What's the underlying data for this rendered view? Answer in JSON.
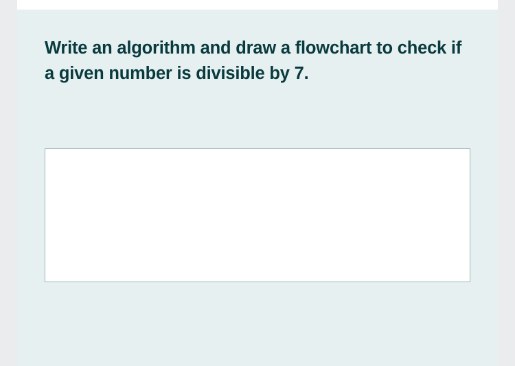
{
  "question": {
    "prompt": "Write an algorithm and draw a flowchart to check if a given number is divisible by 7."
  },
  "answer": {
    "value": "",
    "placeholder": ""
  }
}
